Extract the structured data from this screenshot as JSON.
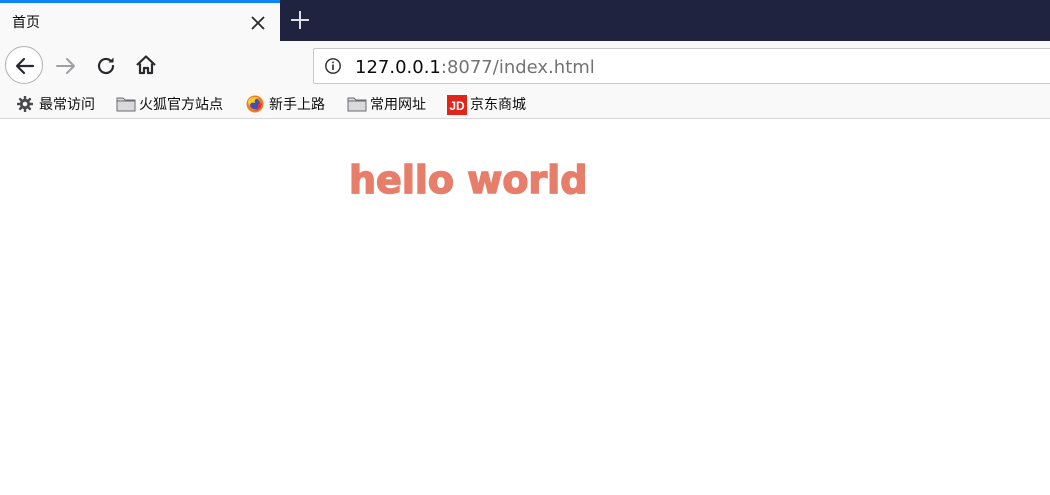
{
  "tab": {
    "title": "首页"
  },
  "urlbar": {
    "host": "127.0.0.1",
    "rest": ":8077/index.html"
  },
  "bookmarks": [
    {
      "label": "最常访问",
      "icon": "gear-icon"
    },
    {
      "label": "火狐官方站点",
      "icon": "folder-icon"
    },
    {
      "label": "新手上路",
      "icon": "firefox-icon"
    },
    {
      "label": "常用网址",
      "icon": "folder-icon"
    },
    {
      "label": "京东商城",
      "icon": "jd-logo",
      "logo_text": "JD"
    }
  ],
  "page": {
    "heading": "hello world",
    "heading_color": "#e67e6a"
  },
  "colors": {
    "tabstrip": "#202340",
    "active_tab_accent": "#0a84ff"
  }
}
